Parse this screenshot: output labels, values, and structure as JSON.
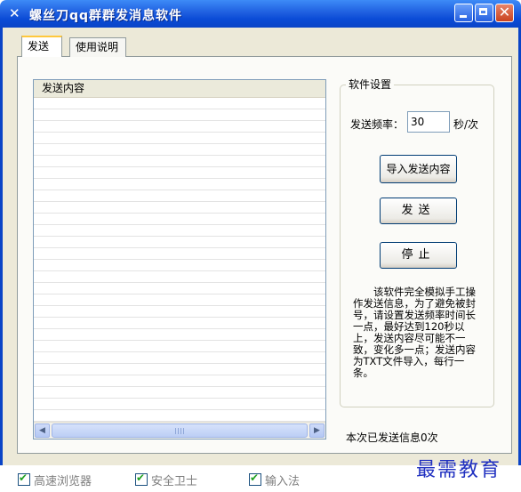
{
  "window": {
    "title": "螺丝刀qq群群发消息软件",
    "icon": "screwdriver-icon",
    "accent": "#0a44c7"
  },
  "tabs": [
    {
      "label": "发送",
      "active": true
    },
    {
      "label": "使用说明",
      "active": false
    }
  ],
  "content_list": {
    "header": "发送内容",
    "rows": []
  },
  "settings": {
    "group_label": "软件设置",
    "frequency_label": "发送频率：",
    "frequency_value": "30",
    "frequency_unit": "秒/次",
    "import_button": "导入发送内容",
    "send_button": "发送",
    "stop_button": "停止",
    "description": "该软件完全模拟手工操作发送信息，为了避免被封号，请设置发送频率时间长一点，最好达到120秒以上，发送内容尽可能不一致，变化多一点；发送内容为TXT文件导入，每行一条。"
  },
  "status": {
    "sent_count_text": "本次已发送信息0次"
  },
  "taskbar_checks": [
    {
      "label": "高速浏览器",
      "checked": true
    },
    {
      "label": "安全卫士",
      "checked": true
    },
    {
      "label": "输入法",
      "checked": true
    }
  ],
  "watermark": "最需教育"
}
